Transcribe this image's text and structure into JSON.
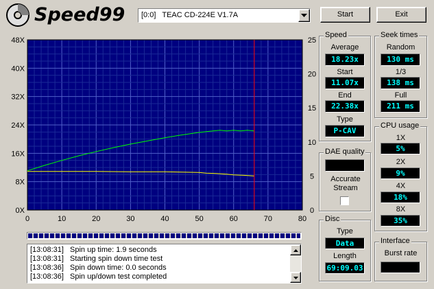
{
  "app": {
    "title": "Speed99"
  },
  "drive": {
    "selected": "[0:0]   TEAC CD-224E V1.7A"
  },
  "buttons": {
    "start": "Start",
    "exit": "Exit"
  },
  "speed": {
    "title": "Speed",
    "average_label": "Average",
    "average": "18.23x",
    "start_label": "Start",
    "start": "11.07x",
    "end_label": "End",
    "end": "22.38x",
    "type_label": "Type",
    "type": "P-CAV"
  },
  "seek": {
    "title": "Seek times",
    "random_label": "Random",
    "random": "130 ms",
    "third_label": "1/3",
    "third": "138 ms",
    "full_label": "Full",
    "full": "211 ms"
  },
  "cpu": {
    "title": "CPU usage",
    "x1_label": "1X",
    "x1": "5%",
    "x2_label": "2X",
    "x2": "9%",
    "x4_label": "4X",
    "x4": "18%",
    "x8_label": "8X",
    "x8": "35%"
  },
  "dae": {
    "title": "DAE quality",
    "value": "",
    "accurate_label": "Accurate Stream"
  },
  "disc": {
    "title": "Disc",
    "type_label": "Type",
    "type": "Data",
    "length_label": "Length",
    "length": "69:09.03"
  },
  "interface": {
    "title": "Interface",
    "burst_label": "Burst rate",
    "burst": ""
  },
  "log": [
    {
      "time": "[13:08:31]",
      "msg": "Spin up time: 1.9 seconds"
    },
    {
      "time": "[13:08:31]",
      "msg": "Starting spin down time test"
    },
    {
      "time": "[13:08:36]",
      "msg": "Spin down time: 0.0 seconds"
    },
    {
      "time": "[13:08:36]",
      "msg": "Spin up/down test completed"
    }
  ],
  "progress": {
    "fraction": 1.0
  },
  "chart_data": {
    "type": "line",
    "xlim": [
      0,
      80
    ],
    "ylim_left": [
      0,
      48
    ],
    "ylim_right": [
      0,
      25
    ],
    "x_ticks": [
      "0",
      "10",
      "20",
      "30",
      "40",
      "50",
      "60",
      "70",
      "80"
    ],
    "y_ticks_left": [
      "0X",
      "8X",
      "16X",
      "24X",
      "32X",
      "40X",
      "48X"
    ],
    "y_ticks_right": [
      "0",
      "5",
      "10",
      "15",
      "20",
      "25"
    ],
    "marker_x": 66,
    "grid": true,
    "colors": {
      "background": "#000080",
      "grid": "#2a3aa8",
      "speed": "#00ff00",
      "cpu": "#ffff00",
      "marker": "#ff0000"
    },
    "series": [
      {
        "color": "#00ff00",
        "axis": "left",
        "x": [
          0,
          5,
          10,
          15,
          20,
          25,
          30,
          35,
          40,
          45,
          50,
          53,
          56,
          58,
          60,
          62,
          64,
          66
        ],
        "y": [
          11.1,
          12.6,
          14.0,
          15.3,
          16.5,
          17.6,
          18.6,
          19.5,
          20.4,
          21.2,
          21.9,
          22.2,
          22.5,
          22.3,
          22.5,
          22.3,
          22.5,
          22.3
        ]
      },
      {
        "color": "#ffff00",
        "axis": "left",
        "x": [
          0,
          10,
          20,
          30,
          40,
          50,
          52,
          55,
          58,
          60,
          63,
          66
        ],
        "y": [
          10.9,
          10.9,
          10.9,
          10.8,
          10.8,
          10.6,
          10.4,
          10.3,
          10.1,
          9.9,
          9.8,
          9.6
        ]
      }
    ]
  }
}
